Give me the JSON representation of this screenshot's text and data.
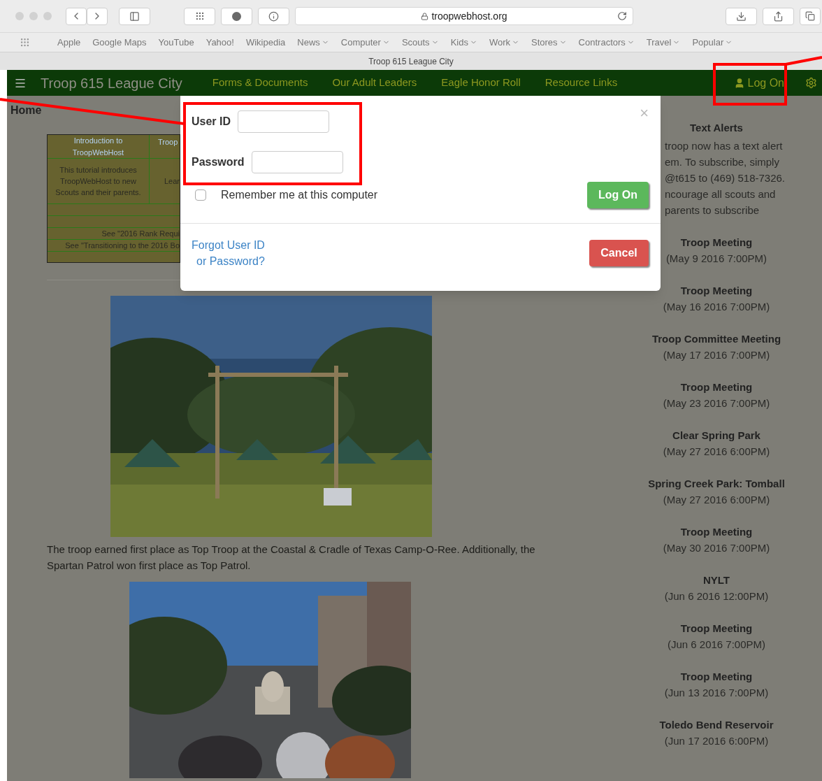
{
  "browser": {
    "url": "troopwebhost.org",
    "tab_title": "Troop 615 League City",
    "bookmarks": [
      {
        "label": "Apple",
        "has_menu": false
      },
      {
        "label": "Google Maps",
        "has_menu": false
      },
      {
        "label": "YouTube",
        "has_menu": false
      },
      {
        "label": "Yahoo!",
        "has_menu": false
      },
      {
        "label": "Wikipedia",
        "has_menu": false
      },
      {
        "label": "News",
        "has_menu": true
      },
      {
        "label": "Computer",
        "has_menu": true
      },
      {
        "label": "Scouts",
        "has_menu": true
      },
      {
        "label": "Kids",
        "has_menu": true
      },
      {
        "label": "Work",
        "has_menu": true
      },
      {
        "label": "Stores",
        "has_menu": true
      },
      {
        "label": "Contractors",
        "has_menu": true
      },
      {
        "label": "Travel",
        "has_menu": true
      },
      {
        "label": "Popular",
        "has_menu": true
      }
    ]
  },
  "nav": {
    "site_title": "Troop 615 League City",
    "links": [
      "Forms & Documents",
      "Our Adult Leaders",
      "Eagle Honor Roll",
      "Resource Links"
    ],
    "login": "Log On"
  },
  "content": {
    "heading": "Home",
    "table": {
      "header": [
        "Introduction to TroopWebHost",
        "Troop"
      ],
      "body": [
        "This tutorial introduces TroopWebHost to new Scouts and their parents.",
        "Lear"
      ],
      "notes": [
        "See \"2016 Rank Requi",
        "See \"Transitioning to the 2016 Bo"
      ]
    },
    "caption": "The troop earned first place as Top Troop at the Coastal & Cradle of Texas Camp-O-Ree. Additionally, the Spartan Patrol won first place as Top Patrol."
  },
  "sidebar": {
    "alert_title": "Text Alerts",
    "alert_lines": [
      "troop now has a text alert",
      "em. To subscribe, simply",
      "@t615 to (469) 518-7326.",
      "ncourage all scouts and",
      "parents to subscribe"
    ],
    "events": [
      {
        "title": "Troop Meeting",
        "date": "(May 9 2016 7:00PM)"
      },
      {
        "title": "Troop Meeting",
        "date": "(May 16 2016 7:00PM)"
      },
      {
        "title": "Troop Committee Meeting",
        "date": "(May 17 2016 7:00PM)"
      },
      {
        "title": "Troop Meeting",
        "date": "(May 23 2016 7:00PM)"
      },
      {
        "title": "Clear Spring Park",
        "date": "(May 27 2016 6:00PM)"
      },
      {
        "title": "Spring Creek Park: Tomball",
        "date": "(May 27 2016 6:00PM)"
      },
      {
        "title": "Troop Meeting",
        "date": "(May 30 2016 7:00PM)"
      },
      {
        "title": "NYLT",
        "date": "(Jun 6 2016 12:00PM)"
      },
      {
        "title": "Troop Meeting",
        "date": "(Jun 6 2016 7:00PM)"
      },
      {
        "title": "Troop Meeting",
        "date": "(Jun 13 2016 7:00PM)"
      },
      {
        "title": "Toledo Bend Reservoir",
        "date": "(Jun 17 2016 6:00PM)"
      }
    ]
  },
  "login_dialog": {
    "user_id_label": "User ID",
    "password_label": "Password",
    "remember_label": "Remember me at this computer",
    "remember_checked": false,
    "close": "×",
    "submit": "Log On",
    "forgot": [
      "Forgot User ID",
      "or Password?"
    ],
    "cancel": "Cancel"
  }
}
